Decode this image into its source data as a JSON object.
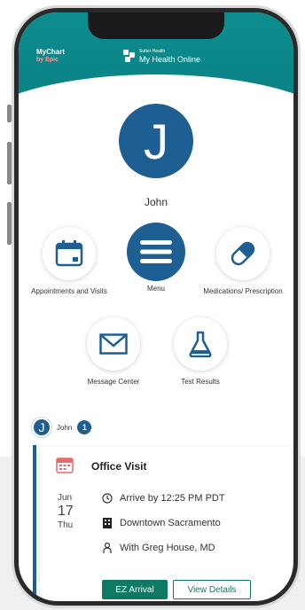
{
  "header": {
    "mychart_line1": "MyChart",
    "mychart_line2": "by Epic",
    "brand_small": "Sutter Health",
    "brand_big": "My Health Online",
    "color": "#0d8d8f"
  },
  "profile": {
    "initial": "J",
    "name": "John",
    "color": "#1d5f92"
  },
  "tiles": [
    {
      "label": "Appointments and Visits",
      "icon": "calendar-icon"
    },
    {
      "label": "Menu",
      "icon": "hamburger-menu-icon"
    },
    {
      "label": "Medications/ Prescription",
      "icon": "pill-capsule-icon"
    },
    {
      "label": "Message Center",
      "icon": "envelope-icon"
    },
    {
      "label": "Test Results",
      "icon": "flask-icon"
    }
  ],
  "account_row": {
    "initial": "J",
    "name": "John",
    "count": "1"
  },
  "visit": {
    "title": "Office Visit",
    "month": "Jun",
    "day": "17",
    "weekday": "Thu",
    "arrive": "Arrive by 12:25 PM PDT",
    "location": "Downtown Sacramento",
    "provider": "With Greg House, MD",
    "primary_button": "EZ Arrival",
    "secondary_button": "View Details",
    "accent": "#0e7a63"
  }
}
